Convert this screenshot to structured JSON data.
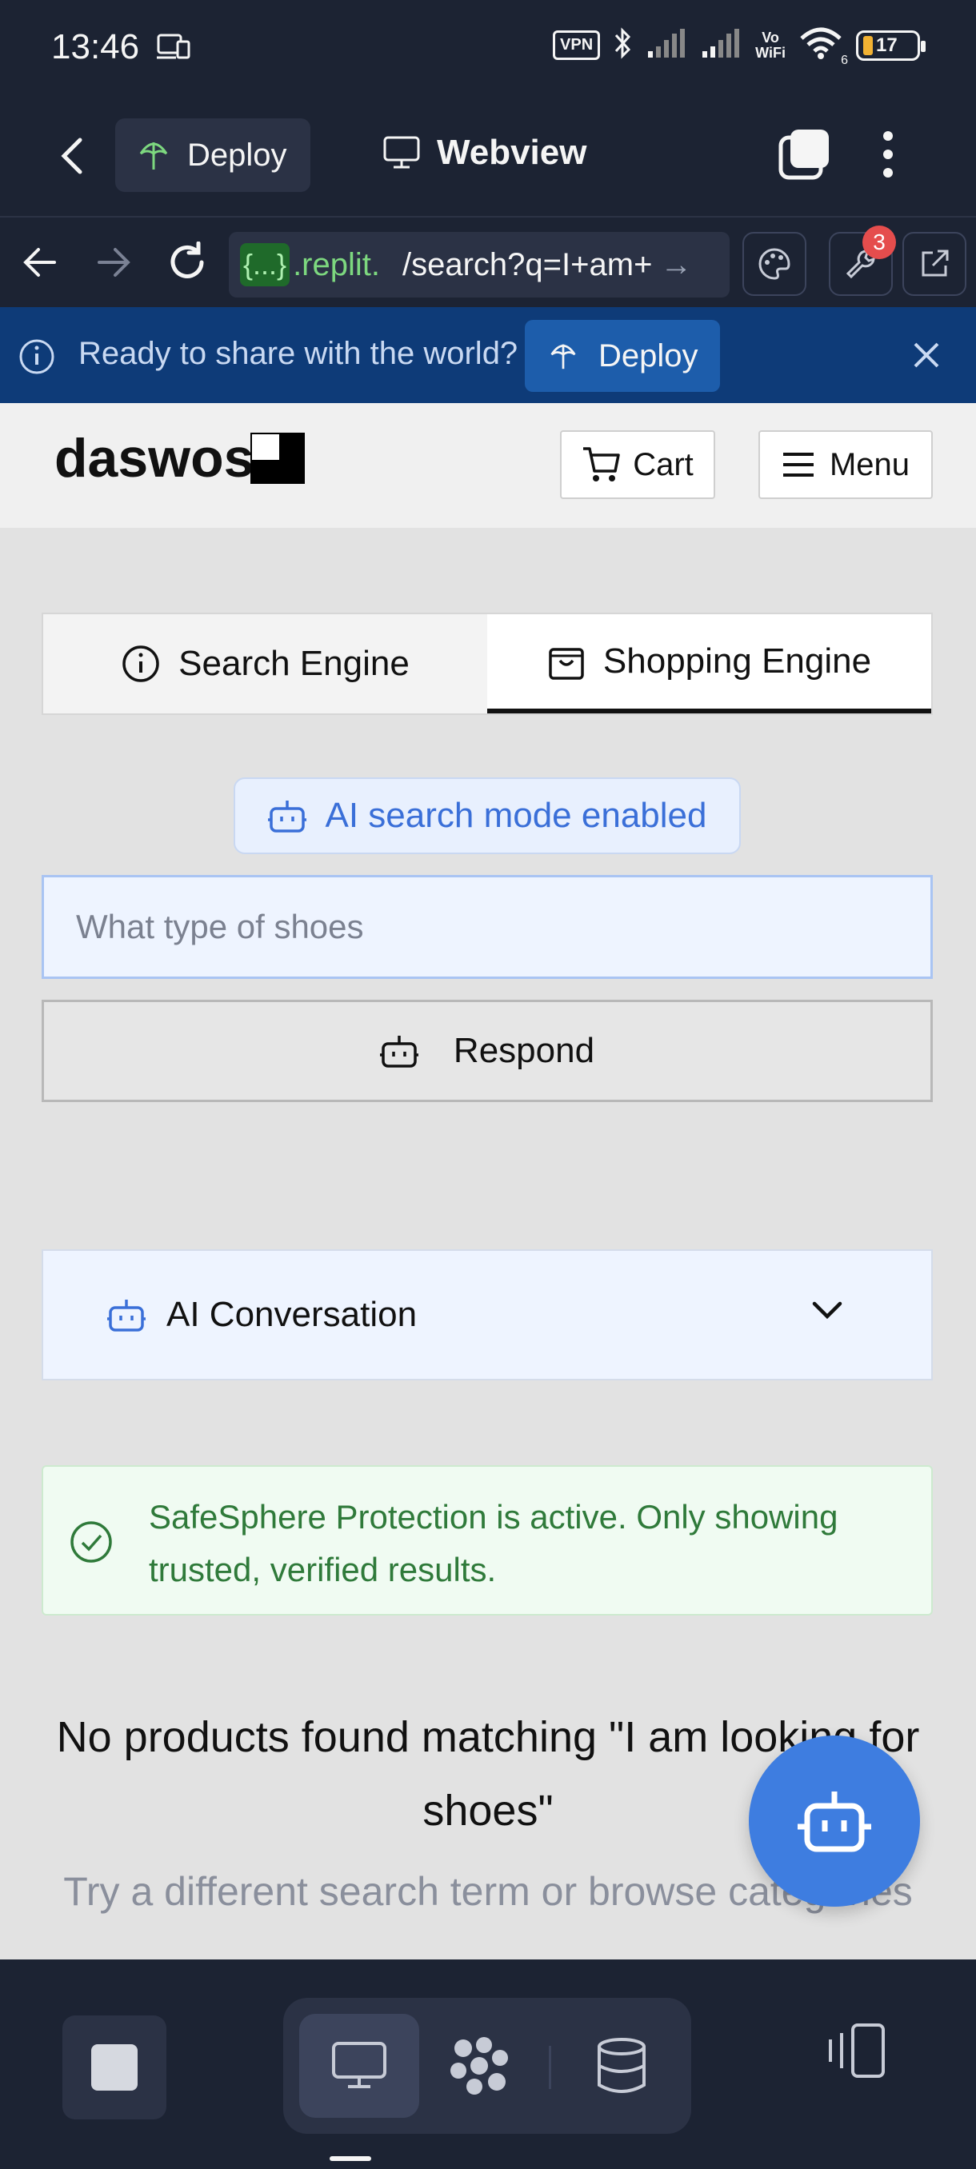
{
  "status_bar": {
    "time": "13:46",
    "vpn": "VPN",
    "vowifi_top": "Vo",
    "vowifi_bottom": "WiFi",
    "wifi_sub": "6",
    "battery": "17"
  },
  "replit_header": {
    "deploy_label": "Deploy",
    "title": "Webview"
  },
  "browser": {
    "url_badge": "{...}",
    "url_domain": ".replit.",
    "url_path": "/search?q=I+am+",
    "url_arrow": "→",
    "tools_badge_count": "3"
  },
  "banner": {
    "text": "Ready to share with the world?",
    "deploy_label": "Deploy"
  },
  "site": {
    "logo_text": "daswos",
    "cart_label": "Cart",
    "menu_label": "Menu",
    "tabs": [
      {
        "label": "Search Engine",
        "active": false
      },
      {
        "label": "Shopping Engine",
        "active": true
      }
    ],
    "ai_mode_label": "AI search mode enabled",
    "search_placeholder": "What type of shoes",
    "respond_label": "Respond",
    "ai_conversation_label": "AI Conversation",
    "safesphere_text": "SafeSphere Protection is active. Only showing trusted, verified results.",
    "no_products_text": "No products found matching \"I am looking for shoes\"",
    "try_different_text": "Try a different search term or browse categories"
  },
  "colors": {
    "replit_bg": "#1c2333",
    "banner_bg": "#0e3b78",
    "accent_blue": "#3e7de0",
    "safesphere_green": "#2f7a3a"
  }
}
